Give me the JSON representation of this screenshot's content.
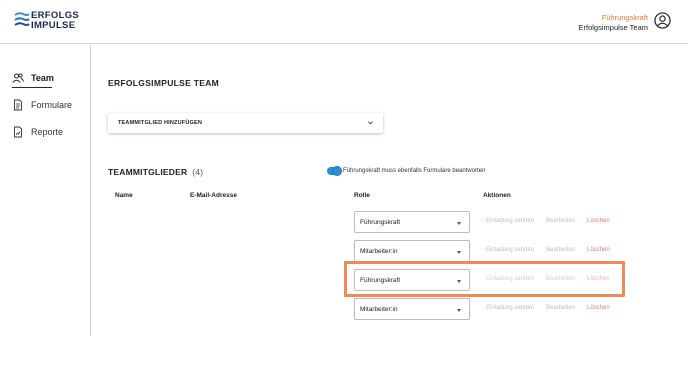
{
  "header": {
    "logo_line1": "ERFOLGS",
    "logo_line2": "IMPULSE",
    "user_role": "Führungskraft",
    "user_team": "Erfolgsimpulse Team",
    "icons": {
      "logo": "wave-logo-icon",
      "avatar": "user-circle-icon"
    },
    "colors": {
      "brand": "#1a2a52",
      "accent": "#e8743b"
    }
  },
  "sidebar": {
    "items": [
      {
        "label": "Team",
        "icon": "team-icon"
      },
      {
        "label": "Formulare",
        "icon": "document-icon"
      },
      {
        "label": "Reporte",
        "icon": "report-icon"
      }
    ]
  },
  "main": {
    "title": "ERFOLGSIMPULSE TEAM",
    "accordion_label": "TEAMMITGLIED HINZUFÜGEN",
    "section_title": "TEAMMITGLIEDER",
    "member_count": "(4)",
    "toggle_label": "Führungskraft muss ebenfalls Formulare beantworten",
    "columns": {
      "name": "Name",
      "email": "E-Mail-Adresse",
      "role": "Rolle",
      "actions": "Aktionen"
    },
    "rows": [
      {
        "role": "Führungskraft",
        "invite": "Einladung senden",
        "edit": "Bearbeiten",
        "delete": "Löschen"
      },
      {
        "role": "Mitarbeiter:in",
        "invite": "Einladung senden",
        "edit": "Bearbeiten",
        "delete": "Löschen"
      },
      {
        "role": "Führungskraft",
        "invite": "Einladung senden",
        "edit": "Bearbeiten",
        "delete": "Löschen"
      },
      {
        "role": "Mitarbeiter:in",
        "invite": "Einladung senden",
        "edit": "Bearbeiten",
        "delete": "Löschen"
      }
    ],
    "highlight_color": "#ee8a55"
  }
}
